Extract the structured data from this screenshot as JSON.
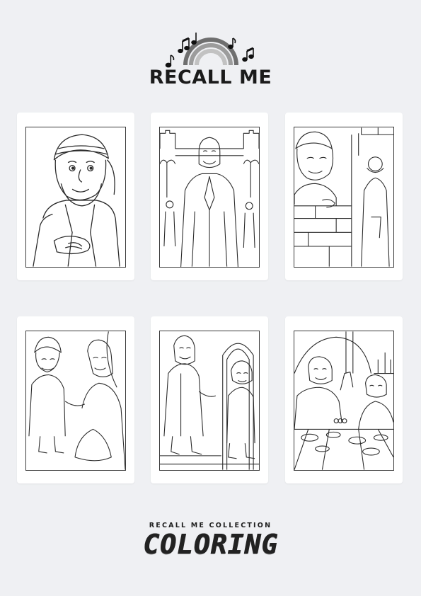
{
  "logo": {
    "text": "RECALL ME",
    "icon": "rainbow-with-music-notes-icon"
  },
  "cards": [
    {
      "scene": "man-with-turban-portrait-icon"
    },
    {
      "scene": "jesus-praying-at-city-gate-icon"
    },
    {
      "scene": "man-at-wall-watching-jesus-icon"
    },
    {
      "scene": "two-men-shaking-hands-icon"
    },
    {
      "scene": "jesus-meeting-man-at-archway-icon"
    },
    {
      "scene": "shared-meal-at-table-icon"
    }
  ],
  "footer": {
    "collection_label": "RECALL ME COLLECTION",
    "title": "COLORING"
  },
  "colors": {
    "background": "#eff0f3",
    "card": "#ffffff",
    "ink": "#1b1b1b"
  }
}
